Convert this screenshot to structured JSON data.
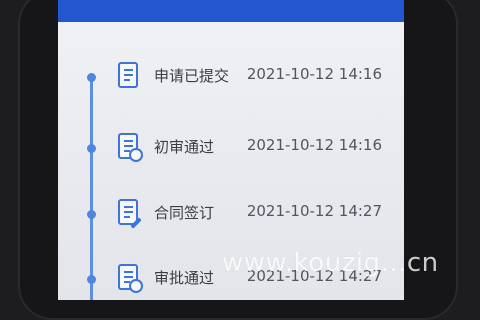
{
  "timeline": {
    "steps": [
      {
        "label": "申请已提交",
        "time": "2021-10-12 14:16",
        "icon": "document-list-icon"
      },
      {
        "label": "初审通过",
        "time": "2021-10-12 14:16",
        "icon": "document-user-icon"
      },
      {
        "label": "合同签订",
        "time": "2021-10-12 14:27",
        "icon": "document-sign-icon"
      },
      {
        "label": "审批通过",
        "time": "2021-10-12 14:27",
        "icon": "document-user-icon"
      }
    ]
  },
  "watermark": "www.kouzig...cn",
  "colors": {
    "appbar": "#2356cf",
    "accent": "#3e74d8",
    "timeline": "#5b8fe0"
  }
}
